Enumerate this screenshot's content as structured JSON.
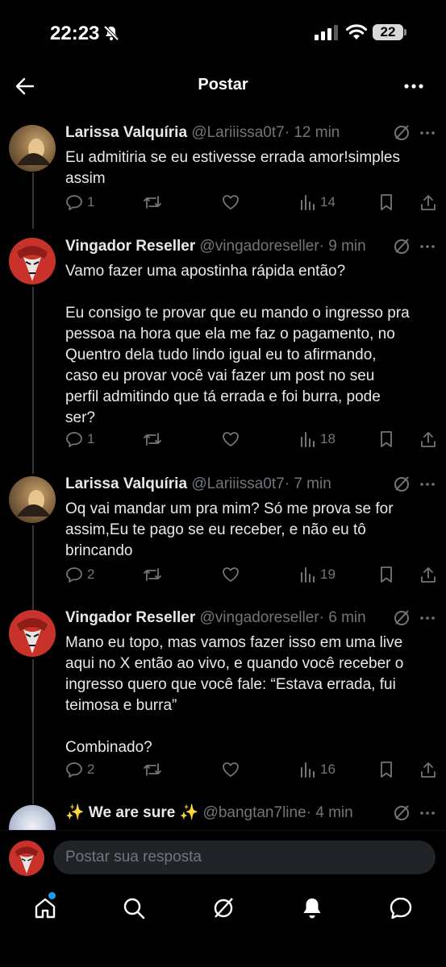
{
  "status_bar": {
    "time": "22:23",
    "battery": "22"
  },
  "header": {
    "title": "Postar"
  },
  "posts": [
    {
      "name": "Larissa Valquíria",
      "handle": "@Lariiissa0t7",
      "time": "· 12 min",
      "text": "Eu admitiria se eu estivesse errada amor!simples\nassim",
      "replies": "1",
      "views": "14"
    },
    {
      "name": "Vingador Reseller",
      "handle": "@vingadoreseller",
      "time": "· 9 min",
      "text": "Vamo fazer uma apostinha rápida então?\n\nEu consigo te provar que eu mando o ingresso pra\npessoa na hora que ela me faz o pagamento, no\nQuentro dela tudo lindo igual eu to afirmando,\ncaso eu provar você vai fazer um post no seu\nperfil admitindo que tá errada e foi burra, pode\nser?",
      "replies": "1",
      "views": "18"
    },
    {
      "name": "Larissa Valquíria",
      "handle": "@Lariiissa0t7",
      "time": "· 7 min",
      "text": "Oq vai mandar um pra mim? Só me prova se for\nassim,Eu te pago se eu receber, e não eu tô\nbrincando",
      "replies": "2",
      "views": "19"
    },
    {
      "name": "Vingador Reseller",
      "handle": "@vingadoreseller",
      "time": "· 6 min",
      "text": "Mano eu topo, mas vamos fazer isso em uma live\naqui no X então ao vivo, e quando você receber o\ningresso quero que você fale: “Estava errada, fui\nteimosa e burra”\n\nCombinado?",
      "replies": "2",
      "views": "16"
    },
    {
      "name": "✨ We are sure ✨",
      "handle": "@bangtan7line",
      "time": "· 4 min"
    }
  ],
  "reply_bar": {
    "placeholder": "Postar sua resposta"
  },
  "icons": {
    "accent": "#1d9bf0",
    "back": "arrow-left-icon",
    "more": "more-horizontal-icon",
    "grok": "grok-icon"
  }
}
